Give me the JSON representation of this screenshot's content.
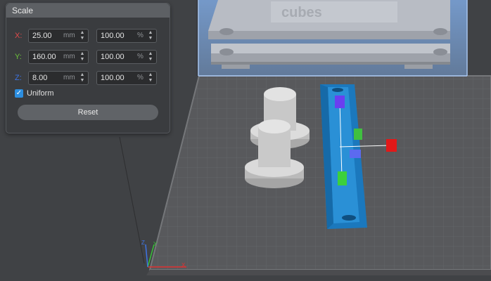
{
  "scale_panel": {
    "title": "Scale",
    "rows": [
      {
        "axis": "X:",
        "axis_color": "#e24a4a",
        "mm_value": "25.00",
        "mm_unit": "mm",
        "pct_value": "100.00",
        "pct_unit": "%"
      },
      {
        "axis": "Y:",
        "axis_color": "#6cc33b",
        "mm_value": "160.00",
        "mm_unit": "mm",
        "pct_value": "100.00",
        "pct_unit": "%"
      },
      {
        "axis": "Z:",
        "axis_color": "#3d74e6",
        "mm_value": "8.00",
        "mm_unit": "mm",
        "pct_value": "100.00",
        "pct_unit": "%"
      }
    ],
    "uniform_label": "Uniform",
    "uniform_checked": true,
    "reset_label": "Reset"
  },
  "viewport": {
    "mini_axes": {
      "x_label": "X",
      "y_label": "Y",
      "z_label": "Z"
    },
    "colors": {
      "bed_plate": "#5a5c5f",
      "bed_grid": "#6c6e71",
      "selected_model": "#1d7fc4",
      "model_gray": "#d2d2d2",
      "build_volume": "#8fb4e8",
      "gizmo_x": "#e01818",
      "gizmo_y": "#38c038",
      "gizmo_z": "#6a3ff0"
    }
  }
}
